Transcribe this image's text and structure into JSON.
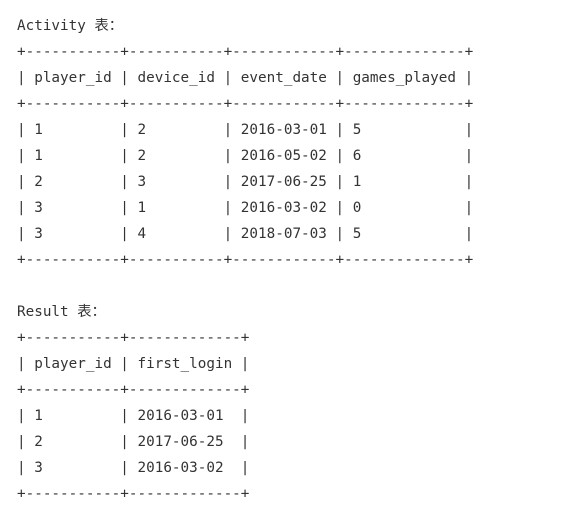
{
  "activity": {
    "title": "Activity 表：",
    "lines": [
      "+-----------+-----------+------------+--------------+",
      "| player_id | device_id | event_date | games_played |",
      "+-----------+-----------+------------+--------------+",
      "| 1         | 2         | 2016-03-01 | 5            |",
      "| 1         | 2         | 2016-05-02 | 6            |",
      "| 2         | 3         | 2017-06-25 | 1            |",
      "| 3         | 1         | 2016-03-02 | 0            |",
      "| 3         | 4         | 2018-07-03 | 5            |",
      "+-----------+-----------+------------+--------------+"
    ]
  },
  "result": {
    "title": "Result 表：",
    "lines": [
      "+-----------+-------------+",
      "| player_id | first_login |",
      "+-----------+-------------+",
      "| 1         | 2016-03-01  |",
      "| 2         | 2017-06-25  |",
      "| 3         | 2016-03-02  |",
      "+-----------+-------------+"
    ]
  }
}
